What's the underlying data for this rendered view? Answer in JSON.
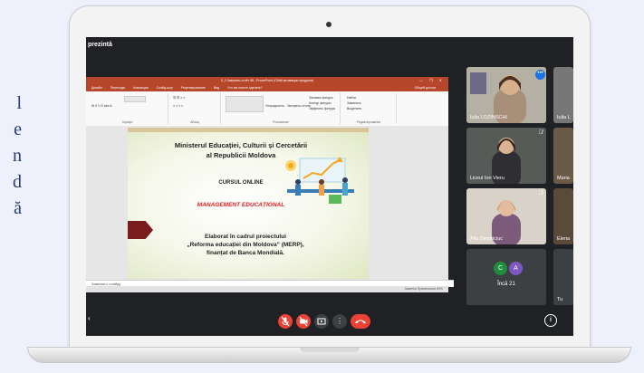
{
  "side_text": {
    "chars": [
      "l",
      "e",
      "n",
      "d",
      "ă"
    ]
  },
  "meet": {
    "presenting_label": "prezintă",
    "participants": [
      {
        "name": "Iulia LOZINSCHI",
        "muted": false,
        "speaking": true
      },
      {
        "name": "Iulia L",
        "muted": false
      },
      {
        "name": "Liceul Ion Vieru",
        "muted": true
      },
      {
        "name": "Maria",
        "muted": false
      },
      {
        "name": "Alla Dimitriciuc",
        "muted": true
      },
      {
        "name": "Elena",
        "muted": false
      },
      {
        "name": "Tu",
        "muted": false
      }
    ],
    "others": {
      "label": "Încă 21",
      "avatars": [
        {
          "letter": "C",
          "color": "#1e8e3e"
        },
        {
          "letter": "A",
          "color": "#7e57c2"
        }
      ]
    },
    "controls": {
      "mic_icon": "mic-off-icon",
      "camera_icon": "camera-off-icon",
      "present_icon": "present-icon",
      "more_icon": "more-vert-icon",
      "hangup_icon": "hangup-icon",
      "info_icon": "info-icon"
    },
    "accent_red": "#ea4335"
  },
  "powerpoint": {
    "window_title": "0_3 Заказать-отчёт 98 - PowerPoint (Сбой активации продукта)",
    "tabs": [
      "Дизайн",
      "Переходы",
      "Анимация",
      "Слайд-шоу",
      "Рецензирование",
      "Вид",
      "Что вы хотите сделать?"
    ],
    "share_label": "Общий доступ",
    "groups": [
      "Шрифт",
      "Абзац",
      "Рисование",
      "Редактирование"
    ],
    "ribbon_items": [
      "Упорядочить",
      "Экспресс-стили",
      "Заливка фигуры",
      "Контур фигуры",
      "Эффекты фигуры",
      "Найти",
      "Заменить",
      "Выделить"
    ],
    "notes_placeholder": "Заметки к слайду",
    "status_right": "Заметки   Примечания   69%"
  },
  "slide": {
    "ministry": "Ministerul Educației, Culturii și Cercetării",
    "republic": "al Republicii Moldova",
    "course": "CURSUL ONLINE",
    "subject": "MANAGEMENT EDUCAȚIONAL",
    "elaborat": "Elaborat în cadrul proiectului",
    "project": "„Reforma educației din Moldova” (MERP),",
    "funded": "finanțat de Banca Mondială."
  }
}
